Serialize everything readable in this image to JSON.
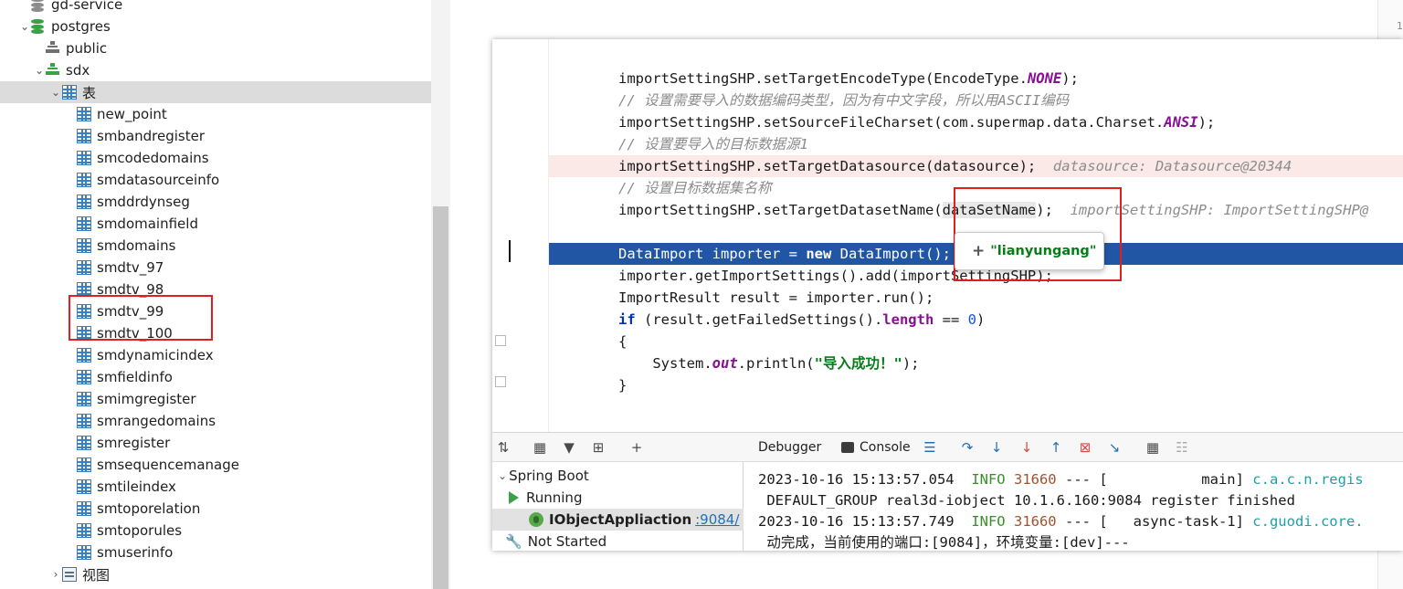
{
  "tree": {
    "items": [
      {
        "label": "gd-service",
        "icon": "database-grey-icon",
        "chevron": "",
        "indent": 40
      },
      {
        "label": "postgres",
        "icon": "database-green-icon",
        "chevron": "expanded",
        "indent": 40
      },
      {
        "label": "public",
        "icon": "schema-grey-icon",
        "chevron": "",
        "indent": 56
      },
      {
        "label": "sdx",
        "icon": "schema-green-icon",
        "chevron": "expanded",
        "indent": 56
      },
      {
        "label": "表",
        "icon": "table-icon",
        "chevron": "expanded",
        "indent": 74,
        "selected": true
      },
      {
        "label": "new_point",
        "icon": "table-icon",
        "indent": 90
      },
      {
        "label": "smbandregister",
        "icon": "table-icon",
        "indent": 90
      },
      {
        "label": "smcodedomains",
        "icon": "table-icon",
        "indent": 90
      },
      {
        "label": "smdatasourceinfo",
        "icon": "table-icon",
        "indent": 90
      },
      {
        "label": "smddrdynseg",
        "icon": "table-icon",
        "indent": 90
      },
      {
        "label": "smdomainfield",
        "icon": "table-icon",
        "indent": 90
      },
      {
        "label": "smdomains",
        "icon": "table-icon",
        "indent": 90
      },
      {
        "label": "smdtv_97",
        "icon": "table-icon",
        "indent": 90
      },
      {
        "label": "smdtv_98",
        "icon": "table-icon",
        "indent": 90
      },
      {
        "label": "smdtv_99",
        "icon": "table-icon",
        "indent": 90
      },
      {
        "label": "smdtv_100",
        "icon": "table-icon",
        "indent": 90
      },
      {
        "label": "smdynamicindex",
        "icon": "table-icon",
        "indent": 90
      },
      {
        "label": "smfieldinfo",
        "icon": "table-icon",
        "indent": 90
      },
      {
        "label": "smimgregister",
        "icon": "table-icon",
        "indent": 90
      },
      {
        "label": "smrangedomains",
        "icon": "table-icon",
        "indent": 90
      },
      {
        "label": "smregister",
        "icon": "table-icon",
        "indent": 90
      },
      {
        "label": "smsequencemanage",
        "icon": "table-icon",
        "indent": 90
      },
      {
        "label": "smtileindex",
        "icon": "table-icon",
        "indent": 90
      },
      {
        "label": "smtoporelation",
        "icon": "table-icon",
        "indent": 90
      },
      {
        "label": "smtoporules",
        "icon": "table-icon",
        "indent": 90
      },
      {
        "label": "smuserinfo",
        "icon": "table-icon",
        "indent": 90
      },
      {
        "label": "视图",
        "icon": "view-icon",
        "chevron": "collapsed",
        "indent": 74
      },
      {
        "label": "",
        "icon": "red-object-icon",
        "chevron": "collapsed",
        "indent": 74
      }
    ]
  },
  "editor": {
    "lines": [
      {
        "t": "importSettingSHP.setTargetEncodeType(EncodeType.",
        "const": "NONE",
        "tail": ");"
      },
      {
        "comment": "// 设置需要导入的数据编码类型，因为有中文字段，所以用ASCII编码"
      },
      {
        "t": "importSettingSHP.setSourceFileCharset(com.supermap.data.Charset.",
        "const": "ANSI",
        "tail": ");"
      },
      {
        "comment": "// 设置要导入的目标数据源1"
      },
      {
        "t": "importSettingSHP.setTargetDatasource(datasource);",
        "hint": "  datasource: Datasource@20344",
        "style": "error"
      },
      {
        "comment": "// 设置目标数据集名称"
      },
      {
        "t": "importSettingSHP.setTargetDatasetName(",
        "var": "dataSetName",
        "tail": ");",
        "hint": "  importSettingSHP: ImportSettingSHP@"
      },
      {
        "t": ""
      },
      {
        "t": "DataImport importer = ",
        "kw": "new",
        "tail": " DataImport();",
        "style": "exec"
      },
      {
        "t": "importer.getImportSettings().add(importSettingSHP);"
      },
      {
        "t": "ImportResult result = importer.run();"
      },
      {
        "kwFirst": "if",
        "t": " (result.getFailedSettings().",
        "len": "length",
        "tail": " == ",
        "num": "0",
        "tail2": ")"
      },
      {
        "t": "{"
      },
      {
        "t": "    System.",
        "fld": "out",
        "tail": ".println(",
        "str": "\"导入成功！\"",
        "tail2": ");"
      },
      {
        "t": "}"
      }
    ]
  },
  "tooltip": {
    "value": "\"lianyungang\""
  },
  "run_panel": {
    "spring_boot": "Spring Boot",
    "running": "Running",
    "app_name": "IObjectAppliaction",
    "app_port": ":9084/",
    "not_started": "Not Started"
  },
  "console_panel": {
    "debugger_tab": "Debugger",
    "console_tab": "Console",
    "lines": [
      {
        "date": "2023-10-16 15:13:57.054",
        "level": "INFO",
        "pid": "31660",
        "sep": " --- [           main] ",
        "cls": "c.a.c.n.regis"
      },
      {
        "text": " DEFAULT_GROUP real3d-iobject 10.1.6.160:9084 register finished"
      },
      {
        "date": "2023-10-16 15:13:57.749",
        "level": "INFO",
        "pid": "31660",
        "sep": " --- [   async-task-1] ",
        "cls": "c.guodi.core."
      },
      {
        "text": " 动完成，当前使用的端口:[9084]，环境变量:[dev]---"
      }
    ]
  },
  "right_strip": {
    "digit": "1"
  },
  "colors": {
    "selection_blue": "#2156a5",
    "highlight_red": "#e02020",
    "info_green": "#3a8f2a"
  }
}
